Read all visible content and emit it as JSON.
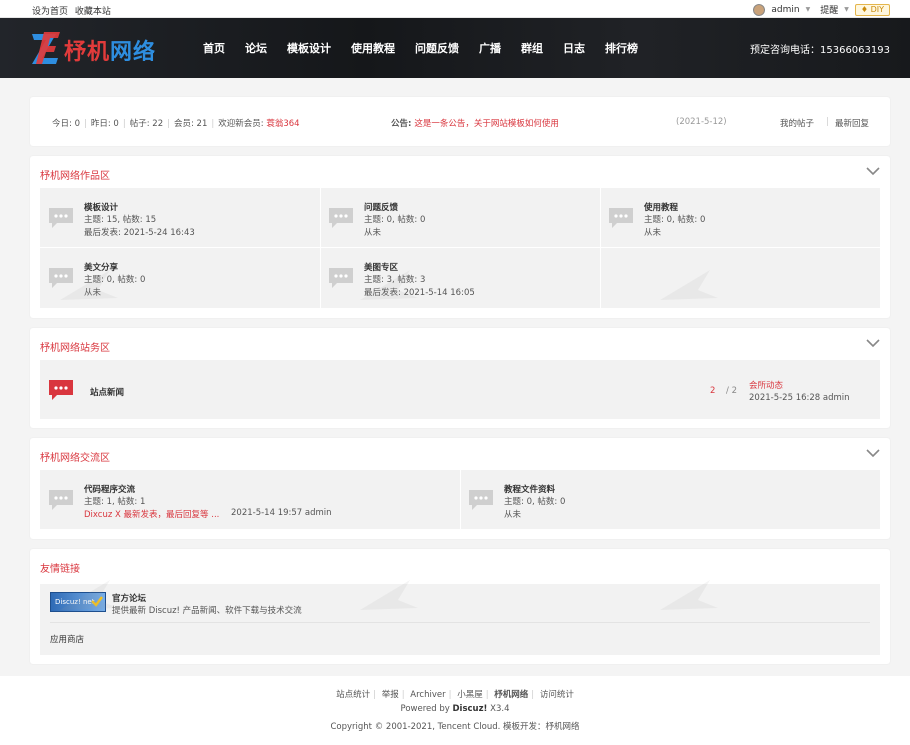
{
  "topbar": {
    "set_home": "设为首页",
    "bookmark": "收藏本站",
    "username": "admin",
    "remind": "提醒",
    "diy": "♦ DIY"
  },
  "header": {
    "logo_red": "杼机",
    "logo_blue": "网络",
    "nav": [
      "首页",
      "论坛",
      "模板设计",
      "使用教程",
      "问题反馈",
      "广播",
      "群组",
      "日志",
      "排行榜"
    ],
    "hotline": "预定咨询电话：15366063193"
  },
  "stats": {
    "today": "今日: 0",
    "yesterday": "昨日: 0",
    "posts": "帖子: 22",
    "members": "会员: 21",
    "welcome_label": "欢迎新会员: ",
    "new_member": "蓑翁364",
    "notice_label": "公告: ",
    "notice_text": "这是一条公告，关于网站模板如何使用",
    "notice_date": "(2021-5-12)",
    "my_posts": "我的帖子",
    "latest_reply": "最新回复"
  },
  "sections": [
    {
      "title": "杼机网络作品区",
      "forums": [
        {
          "name": "模板设计",
          "stats": "主题: 15, 帖数: 15",
          "last": "最后发表: 2021-5-24 16:43"
        },
        {
          "name": "问题反馈",
          "stats": "主题: 0, 帖数: 0",
          "last": "从未"
        },
        {
          "name": "使用教程",
          "stats": "主题: 0, 帖数: 0",
          "last": "从未"
        },
        {
          "name": "美文分享",
          "stats": "主题: 0, 帖数: 0",
          "last": "从未"
        },
        {
          "name": "美图专区",
          "stats": "主题: 3, 帖数: 3",
          "last": "最后发表: 2021-5-14 16:05"
        }
      ]
    },
    {
      "title": "杼机网络站务区",
      "forums": [
        {
          "name": "站点新闻",
          "count": "2",
          "total": "/ 2",
          "last_title": "会所动态",
          "last_info": "2021-5-25 16:28 admin"
        }
      ]
    },
    {
      "title": "杼机网络交流区",
      "forums": [
        {
          "name": "代码程序交流",
          "stats": "主题: 1, 帖数: 1",
          "last_title": "Dixcuz X 最新发表，最后回复等 ...",
          "last_info": "2021-5-14 19:57 admin"
        },
        {
          "name": "教程文件资料",
          "stats": "主题: 0, 帖数: 0",
          "last": "从未"
        }
      ]
    }
  ],
  "links": {
    "title": "友情链接",
    "badge": "Discuz! net",
    "name": "官方论坛",
    "desc": "提供最新 Discuz! 产品新闻、软件下载与技术交流",
    "app_store": "应用商店"
  },
  "footer": {
    "links": [
      "站点统计",
      "举报",
      "Archiver",
      "小黑屋",
      "杼机网络",
      "访问统计"
    ],
    "powered_label": "Powered by ",
    "powered_brand": "Discuz!",
    "powered_ver": " X3.4",
    "copyright": "Copyright © 2001-2021, Tencent Cloud. 模板开发：杼机网络"
  },
  "colors": {
    "accent": "#d9363e",
    "nav_bg": "#1a1c20",
    "logo_blue": "#2e8ee0"
  }
}
